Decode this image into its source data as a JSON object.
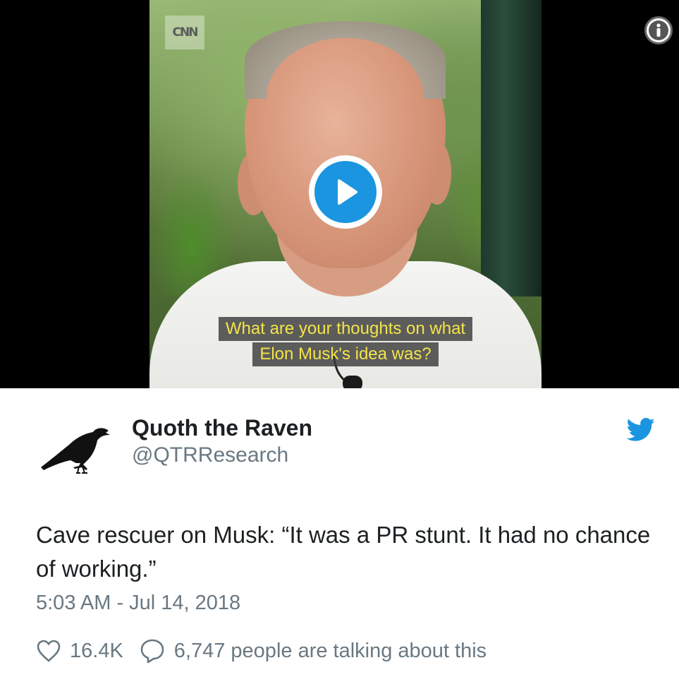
{
  "video": {
    "caption_line1": "What are your thoughts on what",
    "caption_line2": "Elon Musk's idea was?",
    "watermark": "CNN",
    "play_icon": "play-icon",
    "info_icon": "info-icon"
  },
  "author": {
    "display_name": "Quoth the Raven",
    "handle": "@QTRResearch",
    "avatar_icon": "raven-icon"
  },
  "tweet": {
    "text": "Cave rescuer on Musk: “It was a PR stunt. It had no chance of working.”",
    "timestamp": "5:03 AM - Jul 14, 2018"
  },
  "actions": {
    "likes": "16.4K",
    "talking": "6,747 people are talking about this"
  },
  "colors": {
    "accent": "#1b95e0",
    "text": "#1c2022",
    "muted": "#697882",
    "caption": "#f3e44a"
  }
}
